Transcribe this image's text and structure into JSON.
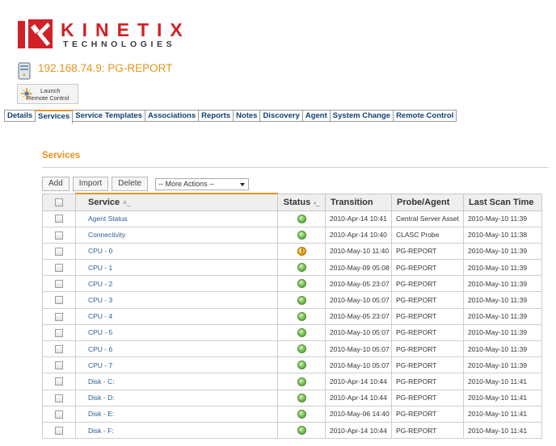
{
  "brand": {
    "name": "KINETIX",
    "tagline": "TECHNOLOGIES",
    "red": "#d22027"
  },
  "host": {
    "title": "192.168.74.9: PG-REPORT",
    "icon": "server-icon",
    "accent": "#e8931a"
  },
  "launch": {
    "line1": "Launch",
    "line2": "Remote Control",
    "icon": "remote-control-icon"
  },
  "tabs": [
    {
      "label": "Details",
      "active": false
    },
    {
      "label": "Services",
      "active": true
    },
    {
      "label": "Service Templates",
      "active": false
    },
    {
      "label": "Associations",
      "active": false
    },
    {
      "label": "Reports",
      "active": false
    },
    {
      "label": "Notes",
      "active": false
    },
    {
      "label": "Discovery",
      "active": false
    },
    {
      "label": "Agent",
      "active": false
    },
    {
      "label": "System Change",
      "active": false
    },
    {
      "label": "Remote Control",
      "active": false
    }
  ],
  "section": {
    "title": "Services"
  },
  "toolbar": {
    "add": "Add",
    "import": "Import",
    "delete": "Delete",
    "actions": "-- More Actions --"
  },
  "columns": {
    "service": "Service",
    "status": "Status",
    "transition": "Transition",
    "probe": "Probe/Agent",
    "scan": "Last Scan Time",
    "service_sort": "˄_",
    "status_sort": "⸗_"
  },
  "rows": [
    {
      "name": "Agent Status",
      "status": "ok",
      "transition": "2010-Apr-14 10:41",
      "probe": "Central Server Asset",
      "scan": "2010-May-10 11:39"
    },
    {
      "name": "Connectivity",
      "status": "ok",
      "transition": "2010-Apr-14 10:40",
      "probe": "CLASC Probe",
      "scan": "2010-May-10 11:38"
    },
    {
      "name": "CPU - 0",
      "status": "warning",
      "transition": "2010-May-10 11:40",
      "probe": "PG-REPORT",
      "scan": "2010-May-10 11:39"
    },
    {
      "name": "CPU - 1",
      "status": "ok",
      "transition": "2010-May-09 05:08",
      "probe": "PG-REPORT",
      "scan": "2010-May-10 11:39"
    },
    {
      "name": "CPU - 2",
      "status": "ok",
      "transition": "2010-May-05 23:07",
      "probe": "PG-REPORT",
      "scan": "2010-May-10 11:39"
    },
    {
      "name": "CPU - 3",
      "status": "ok",
      "transition": "2010-May-10 05:07",
      "probe": "PG-REPORT",
      "scan": "2010-May-10 11:39"
    },
    {
      "name": "CPU - 4",
      "status": "ok",
      "transition": "2010-May-05 23:07",
      "probe": "PG-REPORT",
      "scan": "2010-May-10 11:39"
    },
    {
      "name": "CPU - 5",
      "status": "ok",
      "transition": "2010-May-10 05:07",
      "probe": "PG-REPORT",
      "scan": "2010-May-10 11:39"
    },
    {
      "name": "CPU - 6",
      "status": "ok",
      "transition": "2010-May-10 05:07",
      "probe": "PG-REPORT",
      "scan": "2010-May-10 11:39"
    },
    {
      "name": "CPU - 7",
      "status": "ok",
      "transition": "2010-May-10 05:07",
      "probe": "PG-REPORT",
      "scan": "2010-May-10 11:39"
    },
    {
      "name": "Disk - C:",
      "status": "ok",
      "transition": "2010-Apr-14 10:44",
      "probe": "PG-REPORT",
      "scan": "2010-May-10 11:41"
    },
    {
      "name": "Disk - D:",
      "status": "ok",
      "transition": "2010-Apr-14 10:44",
      "probe": "PG-REPORT",
      "scan": "2010-May-10 11:41"
    },
    {
      "name": "Disk - E:",
      "status": "ok",
      "transition": "2010-May-06 14:40",
      "probe": "PG-REPORT",
      "scan": "2010-May-10 11:41"
    },
    {
      "name": "Disk - F:",
      "status": "ok",
      "transition": "2010-Apr-14 10:44",
      "probe": "PG-REPORT",
      "scan": "2010-May-10 11:41"
    }
  ]
}
